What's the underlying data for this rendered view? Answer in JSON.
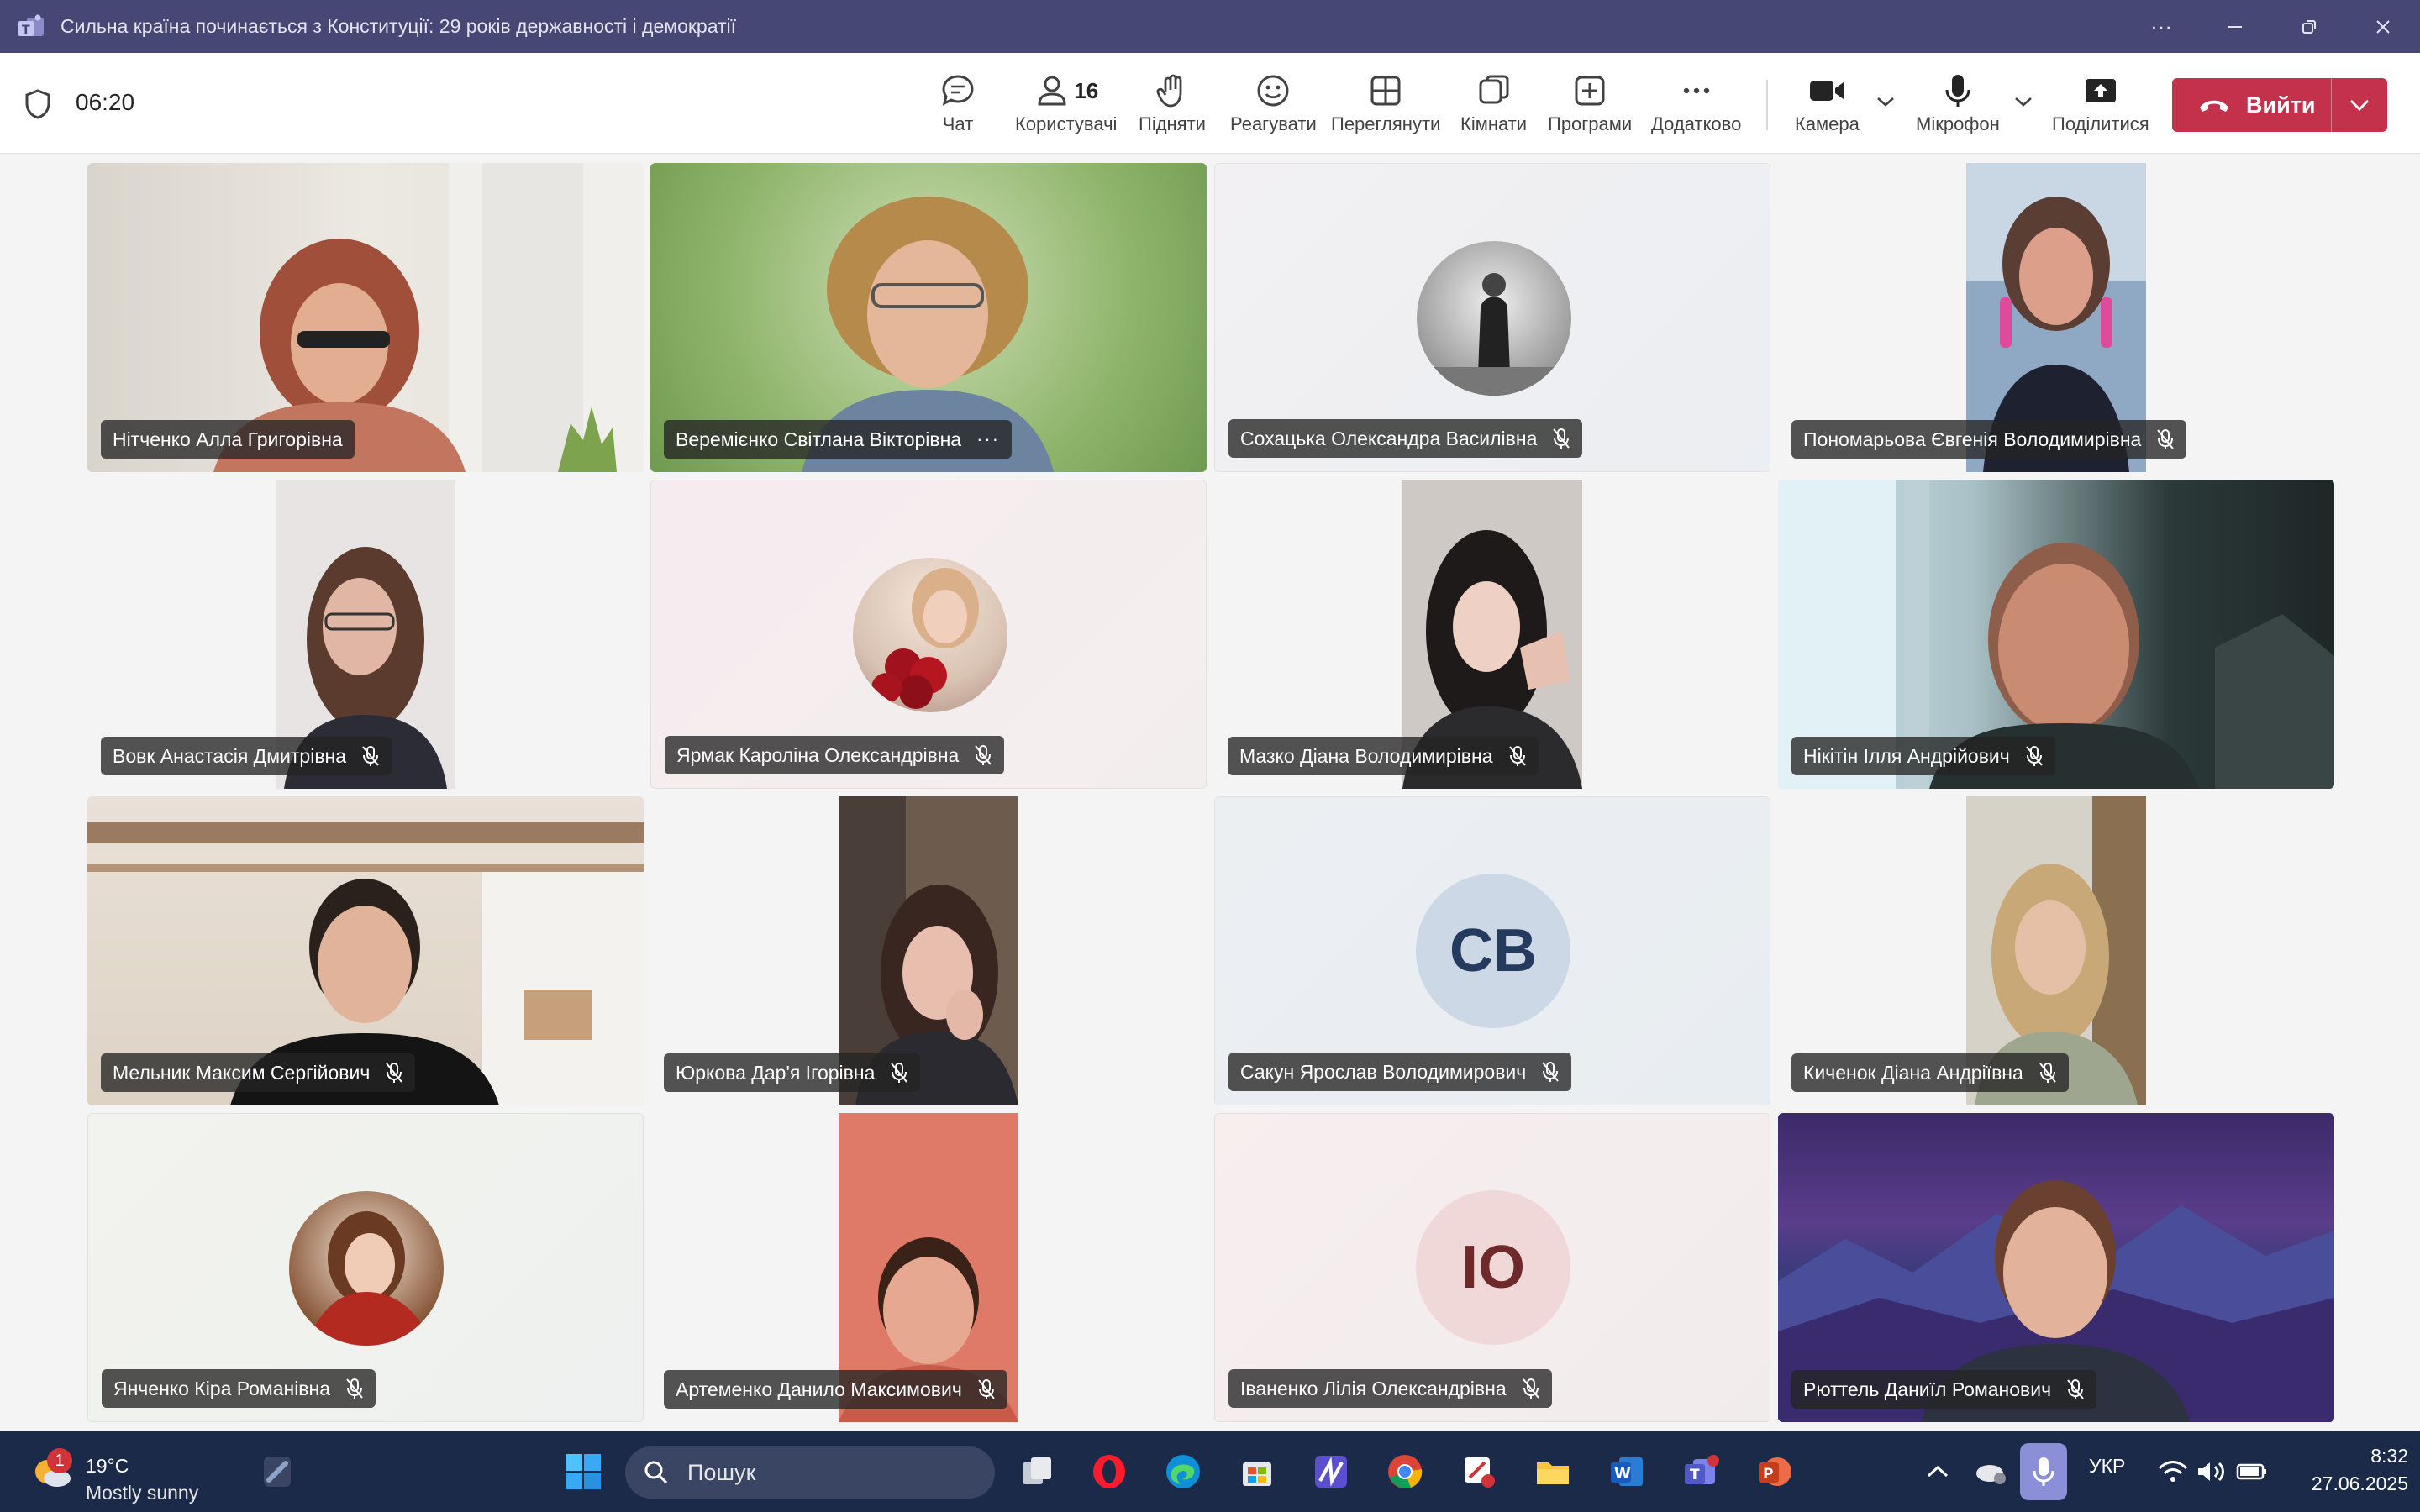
{
  "window": {
    "title": "Сильна країна починається з Конституції: 29 років державності і демократії",
    "more_label": "···"
  },
  "toolbar": {
    "timer": "06:20",
    "chat": "Чат",
    "people": "Користувачі",
    "people_count": "16",
    "raise": "Підняти",
    "react": "Реагувати",
    "view": "Переглянути",
    "rooms": "Кімнати",
    "apps": "Програми",
    "more": "Додатково",
    "camera": "Камера",
    "mic": "Мікрофон",
    "share": "Поділитися",
    "leave": "Вийти"
  },
  "participants": [
    {
      "name": "Нітченко Алла Григорівна",
      "muted": false,
      "kind": "video"
    },
    {
      "name": "Веремієнко Світлана Вікторівна",
      "muted": false,
      "kind": "video",
      "more": "···"
    },
    {
      "name": "Сохацька Олександра Василівна",
      "muted": true,
      "kind": "avatar"
    },
    {
      "name": "Пономарьова Євгенія Володимирівна",
      "muted": true,
      "kind": "video"
    },
    {
      "name": "Вовк Анастасія Дмитрівна",
      "muted": true,
      "kind": "video"
    },
    {
      "name": "Ярмак Кароліна Олександрівна",
      "muted": true,
      "kind": "avatar"
    },
    {
      "name": "Мазко Діана Володимирівна",
      "muted": true,
      "kind": "video"
    },
    {
      "name": "Нікітін Ілля Андрійович",
      "muted": true,
      "kind": "video"
    },
    {
      "name": "Мельник Максим Сергійович",
      "muted": true,
      "kind": "video"
    },
    {
      "name": "Юркова Дар'я Ігорівна",
      "muted": true,
      "kind": "video"
    },
    {
      "name": "Сакун Ярослав Володимирович",
      "muted": true,
      "kind": "initials",
      "initials": "СВ"
    },
    {
      "name": "Киченок Діана Андріївна",
      "muted": true,
      "kind": "video"
    },
    {
      "name": "Янченко Кіра Романівна",
      "muted": true,
      "kind": "avatar"
    },
    {
      "name": "Артеменко Данило Максимович",
      "muted": true,
      "kind": "video"
    },
    {
      "name": "Іваненко Лілія Олександрівна",
      "muted": true,
      "kind": "initials",
      "initials": "ІО"
    },
    {
      "name": "Рюттель Даниїл Романович",
      "muted": true,
      "kind": "video"
    }
  ],
  "taskbar": {
    "weather_temp": "19°C",
    "weather_cond": "Mostly sunny",
    "weather_badge": "1",
    "search_placeholder": "Пошук",
    "language": "УКР",
    "time": "8:32",
    "date": "27.06.2025"
  },
  "colors": {
    "titlebar": "#464775",
    "leave": "#c4314b",
    "taskbar": "#1c2a4a"
  }
}
